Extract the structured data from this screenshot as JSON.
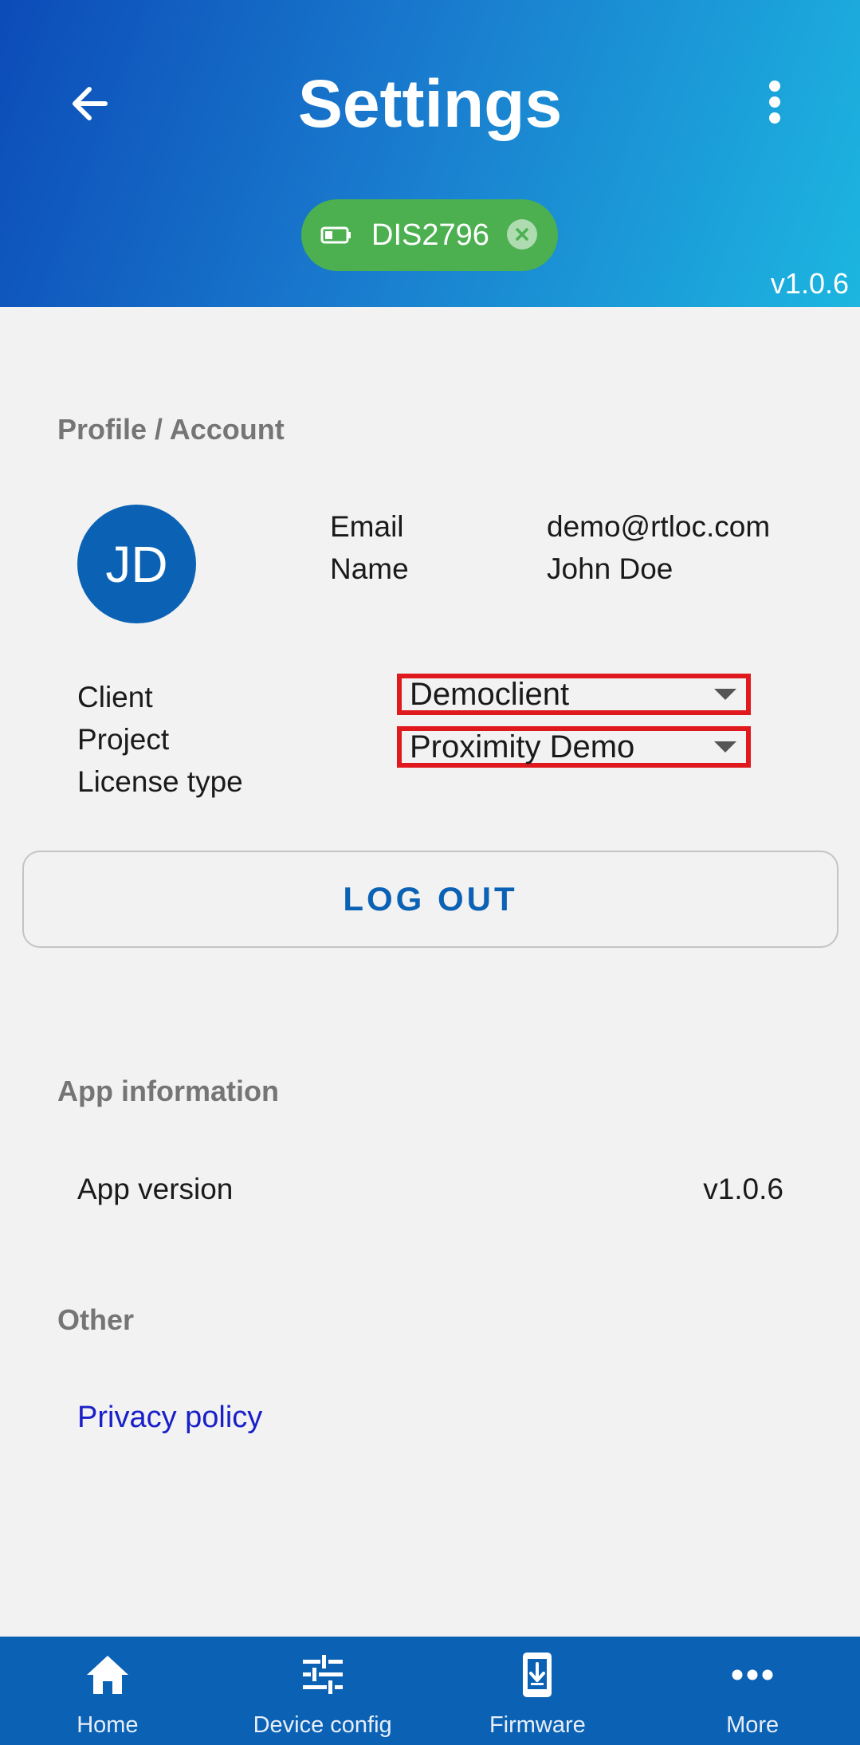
{
  "header": {
    "title": "Settings",
    "device_chip": {
      "label": "DIS2796",
      "color": "#4caf50"
    },
    "version": "v1.0.6",
    "icons": {
      "back": "arrow-left-icon",
      "menu": "more-vert-icon",
      "battery": "battery-icon",
      "close": "close-circle-icon"
    }
  },
  "profile": {
    "section_title": "Profile / Account",
    "avatar_initials": "JD",
    "email_label": "Email",
    "email_value": "demo@rtloc.com",
    "name_label": "Name",
    "name_value": "John Doe",
    "client_label": "Client",
    "client_value": "Democlient",
    "project_label": "Project",
    "project_value": "Proximity Demo",
    "license_label": "License type",
    "logout_label": "LOG OUT"
  },
  "app_info": {
    "section_title": "App information",
    "version_label": "App version",
    "version_value": "v1.0.6"
  },
  "other": {
    "section_title": "Other",
    "privacy_label": "Privacy policy"
  },
  "bottom_nav": {
    "items": [
      {
        "label": "Home",
        "icon": "home-icon"
      },
      {
        "label": "Device config",
        "icon": "sliders-icon"
      },
      {
        "label": "Firmware",
        "icon": "firmware-download-icon"
      },
      {
        "label": "More",
        "icon": "more-horiz-icon"
      }
    ]
  },
  "colors": {
    "header_gradient_start": "#0c4bb8",
    "header_gradient_end": "#1cb6e0",
    "accent": "#0b62b5",
    "highlight_border": "#e0191e",
    "link": "#1a20c8"
  }
}
